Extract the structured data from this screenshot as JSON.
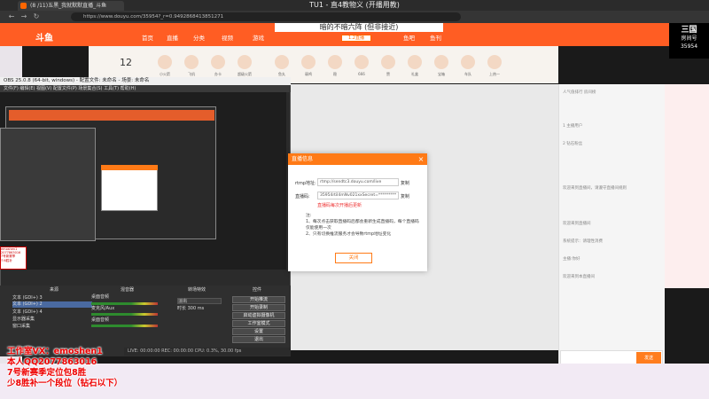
{
  "browser": {
    "tab_title": "(8 /11)五黑_我就默默直播_斗鱼",
    "overlay_title": "TU1 - 直4教物义 (开播用教)",
    "url": "https://www.douyu.com/35954?_r=0.9492868413851271",
    "back_icon": "back-arrow-icon",
    "forward_icon": "forward-arrow-icon",
    "refresh_icon": "refresh-icon"
  },
  "site": {
    "logo": "斗鱼",
    "nav": [
      "首页",
      "直播",
      "分类",
      "视频",
      "游戏",
      "赛事",
      "鱼吧",
      "鱼刊"
    ],
    "room_title": "暗的不暗六阵 (但非接近)",
    "room_id": "1.2直播",
    "banner_lines": [
      "三国",
      "房间号",
      "35954"
    ],
    "count": "12"
  },
  "gifts": [
    "小火箭",
    "飞机",
    "办卡",
    "超级火箭",
    "鱼丸",
    "弱鸡",
    "稳",
    "666",
    "赞",
    "礼盒",
    "宝箱",
    "车队",
    "上热一",
    "直播",
    "礼物",
    "更多"
  ],
  "chat": {
    "lines": [
      "欢迎来到直播间，请遵守直播间规则",
      "人气值排行 房间榜",
      "1 主播用户",
      "2 钻石粉丝",
      "欢迎来到直播间",
      "系统提示：请理性消费",
      "主播:你好",
      "欢迎来到本直播间"
    ],
    "send_label": "发送"
  },
  "obs": {
    "title": "OBS 25.0.8 (64-bit, windows) - 配置文件: 未命名 - 场景: 未命名",
    "menu": "文件(F)  编辑(E)  视图(V)  配置文件(P)  场景集合(S)  工具(T)  帮助(H)",
    "dock_headers": [
      "场景",
      "来源",
      "混音器",
      "转场特效",
      "控件"
    ],
    "sources": [
      "文本 (GDI+) 3",
      "文本 (GDI+) 2",
      "文本 (GDI+) 4",
      "显示器采集",
      "窗口采集"
    ],
    "mixer": [
      "桌面音频",
      "麦克风/Aux",
      "桌面音频"
    ],
    "buttons": [
      "开始推流",
      "开始录制",
      "启动虚拟摄像机",
      "工作室模式",
      "设置",
      "退出"
    ],
    "transition": "淡出",
    "duration": "时长 300 ms",
    "status": "LIVE: 00:00:00   REC: 00:00:00   CPU: 0.3%, 30.00 fps"
  },
  "dialog": {
    "title": "直播信息",
    "rtmp_label": "rtmp地址:",
    "rtmp_value": "rtmp://sendtc3.douyu.com/live",
    "key_label": "直播码:",
    "key_value": "35954rtiI4mNv021xxSecret=*********",
    "copy_label": "复制",
    "warn": "直播码每次开播后更新",
    "note_lines": [
      "注:",
      "1、每次点击获取直播码后都会重新生成直播码，每个直播码仅能使用一次",
      "2、只有切换推流服务才会导致rtmp地址变化"
    ],
    "ok_label": "关闭"
  },
  "ad": {
    "lines": [
      "工作室VX：emoshen1",
      "本人QQ2077863016",
      "7号新赛季定位包8胜",
      "少8胜补一个段位（钻石以下）"
    ],
    "box_lines": [
      "emoshen1",
      "2077863016",
      "7号新赛季",
      "少8胜补"
    ]
  }
}
